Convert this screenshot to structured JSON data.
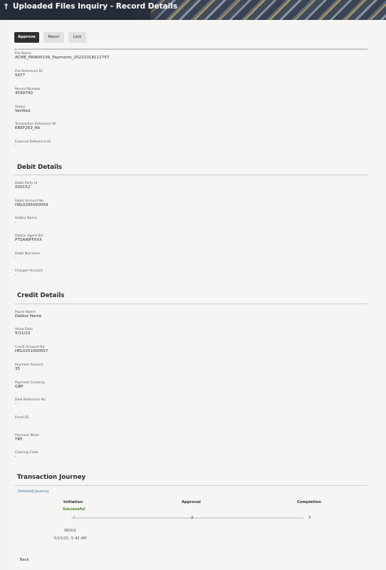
{
  "header": {
    "back_icon": "↑",
    "title": "Uploaded Files Inquiry - Record Details"
  },
  "actions": {
    "approve": "Approve",
    "reject": "Reject",
    "lock": "Lock"
  },
  "record": [
    {
      "label": "File Name",
      "value": "ACME_PAIN001V6_Payments_20221018111757"
    },
    {
      "label": "File Reference ID",
      "value": "5077"
    },
    {
      "label": "Record Number",
      "value": "4599700"
    },
    {
      "label": "Status",
      "value": "Verified"
    },
    {
      "label": "Transaction Reference ID",
      "value": "EREF263_Rb"
    },
    {
      "label": "External Reference ID",
      "value": "-"
    }
  ],
  "debit": {
    "title": "Debit Details",
    "fields": [
      {
        "label": "Debit Party Id",
        "value": "000152"
      },
      {
        "label": "Debit Account No",
        "value": "HEL0285000059"
      },
      {
        "label": "Debtor Name",
        "value": "-"
      },
      {
        "label": "Debtor Agent BIC",
        "value": "PTSAINFFXXX"
      },
      {
        "label": "Debit Narrative",
        "value": "-"
      },
      {
        "label": "Charges Account",
        "value": "-"
      }
    ]
  },
  "credit": {
    "title": "Credit Details",
    "fields": [
      {
        "label": "Payee Name",
        "value": "Debtor Name"
      },
      {
        "label": "Value Date",
        "value": "5/11/22"
      },
      {
        "label": "Credit Account No",
        "value": "HEL0251000057"
      },
      {
        "label": "Payment Amount",
        "value": "35"
      },
      {
        "label": "Payment Currency",
        "value": "GBP"
      },
      {
        "label": "Deal Reference No",
        "value": "-"
      },
      {
        "label": "Email ID",
        "value": ""
      },
      {
        "label": "Payment Mode",
        "value": "TRF"
      },
      {
        "label": "Clearing Code",
        "value": "-"
      }
    ]
  },
  "journey": {
    "title": "Transaction Journey",
    "detailed_link": "Detailed Journey",
    "stages": [
      {
        "name": "Initiation",
        "status": "Successful",
        "step": "✓"
      },
      {
        "name": "Approval",
        "status": "",
        "step": "2"
      },
      {
        "name": "Completion",
        "status": "",
        "step": "3"
      }
    ],
    "user": "INDU2",
    "timestamp": "5/15/25, 5:42 AM"
  },
  "footer": {
    "back": "Back"
  },
  "colors": {
    "header_bg": "#2b3340",
    "primary_button": "#2f2f2f",
    "link": "#3a6ea5",
    "success": "#4f7f2a"
  }
}
